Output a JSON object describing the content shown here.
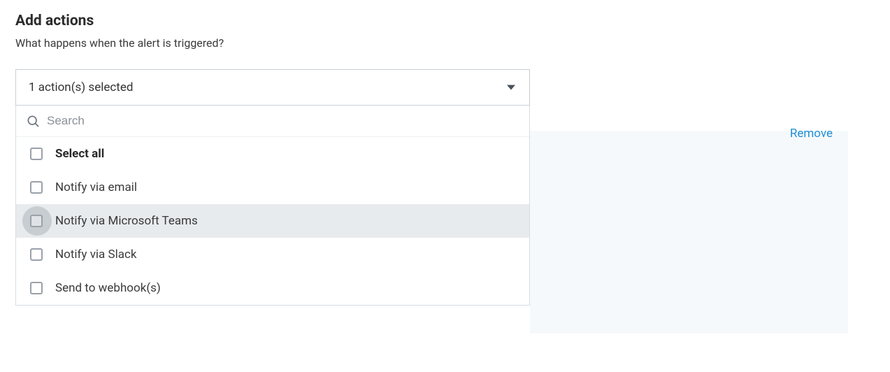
{
  "header": {
    "title": "Add actions",
    "subtitle": "What happens when the alert is triggered?"
  },
  "dropdown": {
    "selected_text": "1 action(s) selected",
    "search_placeholder": "Search",
    "select_all_label": "Select all",
    "options": [
      {
        "label": "Notify via email"
      },
      {
        "label": "Notify via Microsoft Teams"
      },
      {
        "label": "Notify via Slack"
      },
      {
        "label": "Send to webhook(s)"
      }
    ]
  },
  "panel": {
    "remove_label": "Remove"
  }
}
